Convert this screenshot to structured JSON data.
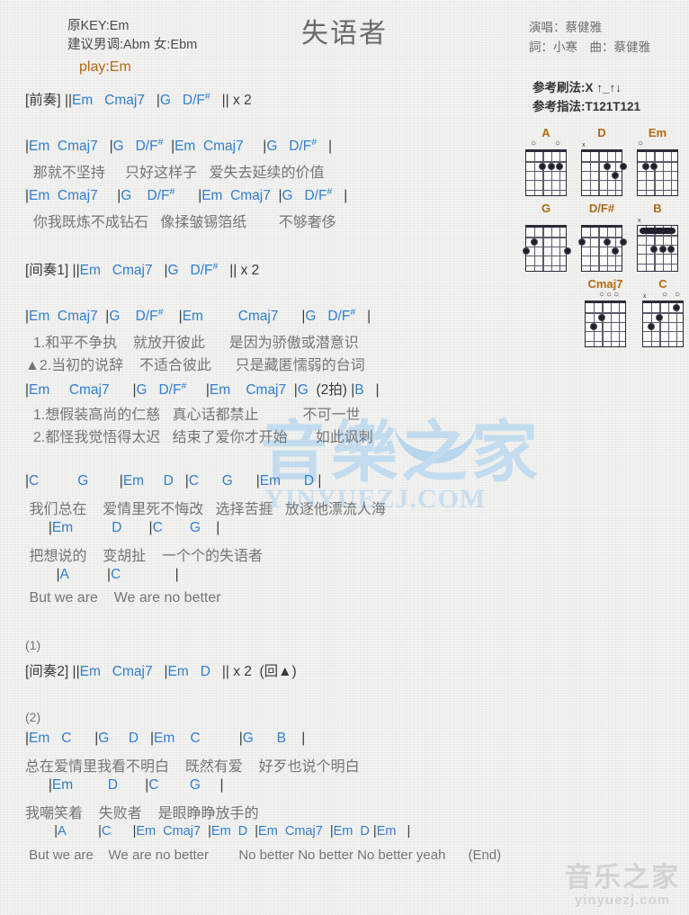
{
  "header": {
    "title": "失语者",
    "orig_key": "原KEY:Em",
    "suggest_key": "建议男调:Abm 女:Ebm",
    "play_key": "play:Em",
    "singer": "演唱：蔡健雅",
    "writers": "詞：小寒　曲：蔡健雅",
    "strum": "参考刷法:X ↑_↑↓",
    "fingering": "参考指法:T121T121"
  },
  "chords": [
    {
      "name": "A",
      "marks": [
        {
          "t": "o",
          "x": 6
        },
        {
          "t": "o",
          "x": 33
        }
      ],
      "nut": true,
      "dots": [
        {
          "s": 2,
          "f": 2
        },
        {
          "s": 3,
          "f": 2
        },
        {
          "s": 4,
          "f": 2
        }
      ],
      "barre": null
    },
    {
      "name": "D",
      "marks": [
        {
          "t": "x",
          "x": 1
        }
      ],
      "nut": true,
      "dots": [
        {
          "s": 3,
          "f": 2
        },
        {
          "s": 5,
          "f": 2
        },
        {
          "s": 4,
          "f": 3
        }
      ],
      "barre": null
    },
    {
      "name": "Em",
      "marks": [
        {
          "t": "o",
          "x": 1
        }
      ],
      "nut": true,
      "dots": [
        {
          "s": 1,
          "f": 2
        },
        {
          "s": 2,
          "f": 2
        }
      ],
      "barre": null
    },
    {
      "name": "G",
      "marks": [],
      "nut": true,
      "dots": [
        {
          "s": 1,
          "f": 2
        },
        {
          "s": 0,
          "f": 3
        },
        {
          "s": 5,
          "f": 3
        }
      ],
      "barre": null
    },
    {
      "name": "D/F#",
      "marks": [],
      "nut": true,
      "dots": [
        {
          "s": 0,
          "f": 2
        },
        {
          "s": 3,
          "f": 2
        },
        {
          "s": 5,
          "f": 2
        },
        {
          "s": 4,
          "f": 3
        }
      ],
      "barre": null
    },
    {
      "name": "B",
      "marks": [
        {
          "t": "x",
          "x": 1
        }
      ],
      "nut": false,
      "dots": [
        {
          "s": 2,
          "f": 3
        },
        {
          "s": 3,
          "f": 3
        },
        {
          "s": 4,
          "f": 3
        }
      ],
      "barre": {
        "f": 1
      }
    },
    {
      "name": "Cmaj7",
      "marks": [
        {
          "t": "o",
          "x": 16
        },
        {
          "t": "o",
          "x": 24
        },
        {
          "t": "o",
          "x": 32
        }
      ],
      "nut": true,
      "dots": [
        {
          "s": 2,
          "f": 2
        },
        {
          "s": 1,
          "f": 3
        }
      ],
      "barre": null
    },
    {
      "name": "C",
      "marks": [
        {
          "t": "x",
          "x": 1
        },
        {
          "t": "o",
          "x": 22
        },
        {
          "t": "o",
          "x": 36
        }
      ],
      "nut": true,
      "dots": [
        {
          "s": 4,
          "f": 1
        },
        {
          "s": 2,
          "f": 2
        },
        {
          "s": 1,
          "f": 3
        }
      ],
      "barre": null
    }
  ],
  "song": {
    "intro_chords": "[前奏] ||Em   Cmaj7   |G   D/F#   || x 2",
    "v1_l1_chords": "|Em  Cmaj7   |G   D/F#  |Em  Cmaj7     |G   D/F#   |",
    "v1_l1_lyric": "  那就不坚持     只好这样子   爱失去延续的价值",
    "v1_l2_chords": "|Em  Cmaj7     |G    D/F#      |Em  Cmaj7  |G   D/F#   |",
    "v1_l2_lyric": "  你我既炼不成钻石   像揉皱锡箔纸        不够奢侈",
    "inter1_chords": "[间奏1] ||Em   Cmaj7   |G   D/F#   || x 2",
    "v2_l1_chords": "|Em  Cmaj7  |G    D/F#    |Em         Cmaj7      |G   D/F#   |",
    "v2_l1_lyric1": "  1.和平不争执    就放开彼此      是因为骄傲或潜意识",
    "v2_l1_lyric2": "▲2.当初的说辞    不适合彼此      只是藏匿懦弱的台词",
    "v2_l2_chords": "|Em     Cmaj7      |G   D/F#     |Em    Cmaj7  |G  (2拍) |B   |",
    "v2_l2_lyric1": "  1.想假装高尚的仁慈   真心话都禁止           不可一世",
    "v2_l2_lyric2": "  2.都怪我觉悟得太迟   结束了爱你才开始       如此讽刺",
    "ch_l1_chords": "|C          G        |Em     D   |C      G      |Em      D |",
    "ch_l1_lyric": " 我们总在    爱情里死不悔改   选择苦捱   放逐他漂流人海",
    "ch_l2_chords": "      |Em          D       |C       G    |",
    "ch_l2_lyric": " 把想说的    变胡扯    一个个的失语者",
    "ch_l3_chords": "        |A          |C              |",
    "ch_l3_lyric": " But we are    We are no better",
    "mark1": "(1)",
    "inter2_chords": "[间奏2] ||Em   Cmaj7   |Em   D   || x 2  (回▲)",
    "mark2": "(2)",
    "v3_l1_chords": "|Em   C      |G     D   |Em    C          |G      B    |",
    "v3_l1_lyric": "总在爱情里我看不明白    既然有爱    好歹也说个明白",
    "v3_l2_chords": "      |Em         D       |C        G     |",
    "v3_l2_lyric": "我嘲笑着    失败者    是眼睁睁放手的",
    "v3_l3_chords": "        |A         |C      |Em  Cmaj7  |Em  D  |Em  Cmaj7  |Em  D |Em   |",
    "v3_l3_lyric": " But we are    We are no better        No better No better No better yeah      (End)"
  },
  "watermark": {
    "center_cn": "音樂之家",
    "center_en": "YINYUEZJ.COM",
    "corner_cn": "音乐之家",
    "corner_url": "yinyuezj.com"
  }
}
